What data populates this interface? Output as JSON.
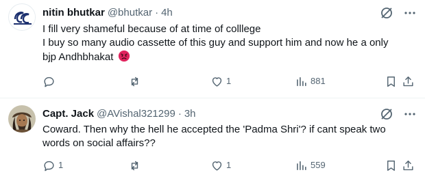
{
  "tweets": [
    {
      "author": {
        "name": "nitin bhutkar",
        "handle": "@bhutkar",
        "avatar_icon": "circle-logo-avatar"
      },
      "separator": "·",
      "time": "4h",
      "lines": [
        "I  fill very shameful because of at time of colllege",
        "I buy so many audio cassette of this guy and support him and now he a only",
        "bjp Andhbhakat"
      ],
      "emoji": "angry-face",
      "actions": {
        "reply": "",
        "retweet": "",
        "like": "1",
        "views": "881"
      }
    },
    {
      "author": {
        "name": "Capt. Jack",
        "handle": "@AVishal321299",
        "avatar_icon": "pirate-photo-avatar"
      },
      "separator": "·",
      "time": "3h",
      "lines": [
        "Coward. Then why the hell he accepted the 'Padma Shri'? if cant speak two",
        "words on social affairs??"
      ],
      "actions": {
        "reply": "1",
        "retweet": "",
        "like": "1",
        "views": "559"
      }
    }
  ],
  "colors": {
    "text": "#0f1419",
    "secondary": "#536471",
    "divider": "#eff3f4",
    "emoji_red": "#e0245e"
  }
}
